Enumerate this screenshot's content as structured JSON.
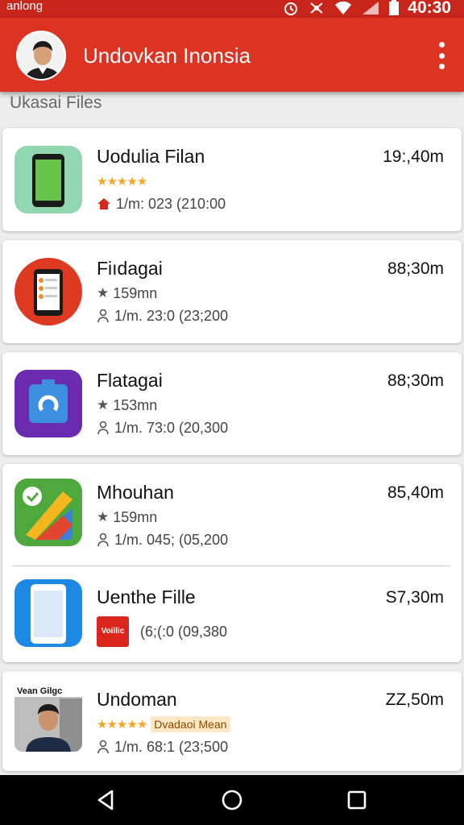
{
  "status_bar": {
    "carrier": "anlong",
    "time": "40:30"
  },
  "app_bar": {
    "title": "Undovkan Inonsia",
    "avatar": "profile-avatar",
    "menu_icon": "more-vert-icon"
  },
  "section": {
    "title": "Ukasai Files"
  },
  "files": [
    {
      "name": "Uodulia Filan",
      "size": "19:,40m",
      "rating_stars": 5,
      "meta": "1/m: 023 (210:00",
      "meta_icon": "home-icon",
      "icon": "green-phone-app-icon"
    },
    {
      "name": "Fiıdagai",
      "size": "88;30m",
      "rating": "159mn",
      "meta": "1/m. 23:0 (23;200",
      "meta_icon": "person-icon",
      "icon": "red-phone-app-icon"
    },
    {
      "name": "Flatagai",
      "size": "88;30m",
      "rating": "153mn",
      "meta": "1/m. 73:0 (20,300",
      "meta_icon": "person-icon",
      "icon": "purple-app-icon"
    },
    {
      "name": "Mhouhan",
      "size": "85,40m",
      "rating": "159mn",
      "meta": "1/m. 045; (05,200",
      "meta_icon": "person-icon",
      "icon": "maps-app-icon"
    },
    {
      "name": "Uenthe Fille",
      "size": "S7,30m",
      "badge": "Voillic",
      "meta": "(6;(:0 (09,380",
      "icon": "blue-phone-app-icon"
    },
    {
      "name": "Undoman",
      "size": "ZZ,50m",
      "rating_stars": 5,
      "tag": "Dvadaoi Mean",
      "meta": "1/m. 68:1 (23;500",
      "meta_icon": "person-icon",
      "icon": "photo-app-icon",
      "icon_caption": "Vean  Gilgc"
    }
  ],
  "nav_bar": {
    "back_icon": "back-icon",
    "home_icon": "home-circle-icon",
    "recents_icon": "recents-icon"
  },
  "colors": {
    "app_bar": "#dc3322",
    "status_bar": "#c8261b",
    "star": "#f5a623"
  }
}
